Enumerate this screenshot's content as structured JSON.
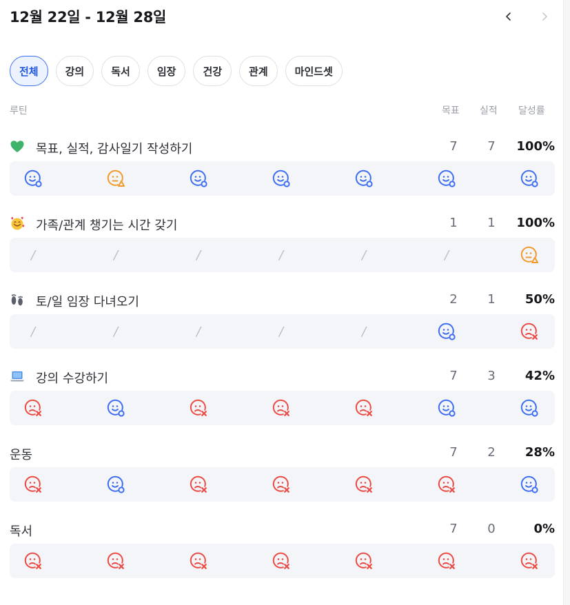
{
  "header": {
    "title": "12월 22일 - 12월 28일",
    "prev_icon": "chevron-left-icon",
    "next_icon": "chevron-right-icon"
  },
  "tabs": [
    {
      "label": "전체",
      "active": true
    },
    {
      "label": "강의",
      "active": false
    },
    {
      "label": "독서",
      "active": false
    },
    {
      "label": "임장",
      "active": false
    },
    {
      "label": "건강",
      "active": false
    },
    {
      "label": "관계",
      "active": false
    },
    {
      "label": "마인드셋",
      "active": false
    }
  ],
  "columns": {
    "routine": "루틴",
    "goal": "목표",
    "actual": "실적",
    "rate": "달성률"
  },
  "colors": {
    "success": "#3e6ef0",
    "partial": "#f09a2c",
    "fail": "#ea4b45",
    "accent": "#1f56e0"
  },
  "routines": [
    {
      "emoji": "green-heart-icon",
      "name": "목표, 실적, 감사일기 작성하기",
      "goal": "7",
      "actual": "7",
      "rate": "100%",
      "days": [
        "success",
        "partial",
        "success",
        "success",
        "success",
        "success",
        "success"
      ]
    },
    {
      "emoji": "smiling-face-with-hearts-icon",
      "name": "가족/관계 챙기는 시간 갖기",
      "goal": "1",
      "actual": "1",
      "rate": "100%",
      "days": [
        "none",
        "none",
        "none",
        "none",
        "none",
        "none",
        "partial"
      ]
    },
    {
      "emoji": "footprints-icon",
      "name": "토/일 임장 다녀오기",
      "goal": "2",
      "actual": "1",
      "rate": "50%",
      "days": [
        "none",
        "none",
        "none",
        "none",
        "none",
        "success",
        "fail"
      ]
    },
    {
      "emoji": "laptop-icon",
      "name": "강의 수강하기",
      "goal": "7",
      "actual": "3",
      "rate": "42%",
      "days": [
        "fail",
        "success",
        "fail",
        "fail",
        "fail",
        "success",
        "success"
      ]
    },
    {
      "emoji": "",
      "name": "운동",
      "goal": "7",
      "actual": "2",
      "rate": "28%",
      "days": [
        "fail",
        "success",
        "fail",
        "fail",
        "fail",
        "fail",
        "success"
      ]
    },
    {
      "emoji": "",
      "name": "독서",
      "goal": "7",
      "actual": "0",
      "rate": "0%",
      "days": [
        "fail",
        "fail",
        "fail",
        "fail",
        "fail",
        "fail",
        "fail"
      ]
    }
  ],
  "slash_text": "/"
}
